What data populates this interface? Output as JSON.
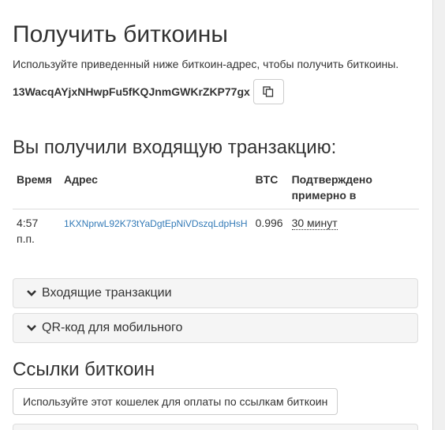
{
  "page": {
    "title": "Получить биткоины",
    "instructions": "Используйте приведенный ниже биткоин-адрес, чтобы получить биткоины.",
    "address": "13WacqAYjxNHwpFu5fKQJnmGWKrZKP77gx",
    "copy_icon": "copy-icon"
  },
  "incoming": {
    "title": "Вы получили входящую транзакцию:",
    "headers": {
      "time": "Время",
      "address": "Адрес",
      "btc": "BTC",
      "confirmed": "Подтверждено примерно в"
    },
    "rows": [
      {
        "time": "4:57 п.п.",
        "address": "1KXNprwL92K73tYaDgtEpNiVDszqLdpHsH",
        "btc": "0.996",
        "confirmed": "30 минут"
      }
    ]
  },
  "accordions": {
    "incoming_tx": "Входящие транзакции",
    "qr_mobile": "QR-код для мобильного",
    "icon": "chevron-down-icon"
  },
  "links": {
    "title": "Ссылки биткоин",
    "button": "Используйте этот кошелек для оплаты по ссылкам биткоин"
  },
  "colors": {
    "link": "#337ab7",
    "text": "#333333",
    "border": "#dddddd",
    "panel_bg": "#f5f5f5"
  }
}
